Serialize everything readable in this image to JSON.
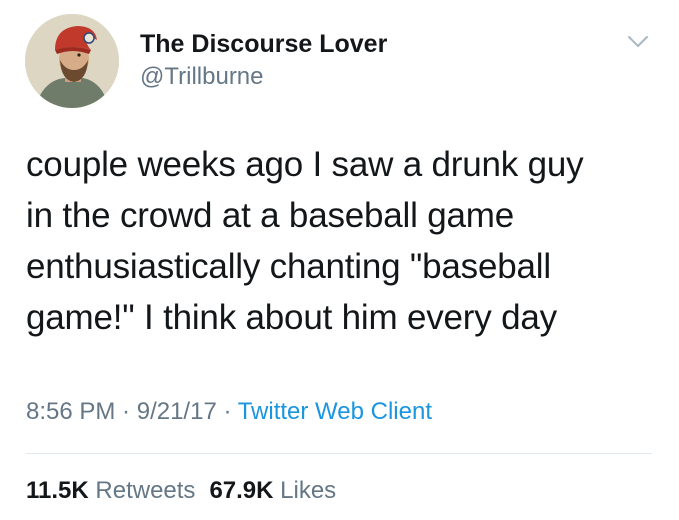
{
  "author": {
    "display_name": "The Discourse Lover",
    "handle": "@Trillburne",
    "avatar_icon": "profile-avatar-bearded-man-red-cap"
  },
  "menu_icon": "chevron-down-icon",
  "tweet": {
    "lines": [
      "couple weeks ago I saw a drunk guy",
      "in the crowd at a baseball game",
      "enthusiastically chanting \"baseball",
      "game!\" I think about him every day"
    ]
  },
  "meta": {
    "time": "8:56 PM",
    "separator": " · ",
    "date": "9/21/17",
    "source": "Twitter Web Client"
  },
  "stats": {
    "retweets_count": "11.5K",
    "retweets_label": "Retweets",
    "likes_count": "67.9K",
    "likes_label": "Likes"
  },
  "colors": {
    "text": "#14171a",
    "secondary": "#657786",
    "link": "#1b95e0",
    "divider": "#e1e8ed"
  }
}
